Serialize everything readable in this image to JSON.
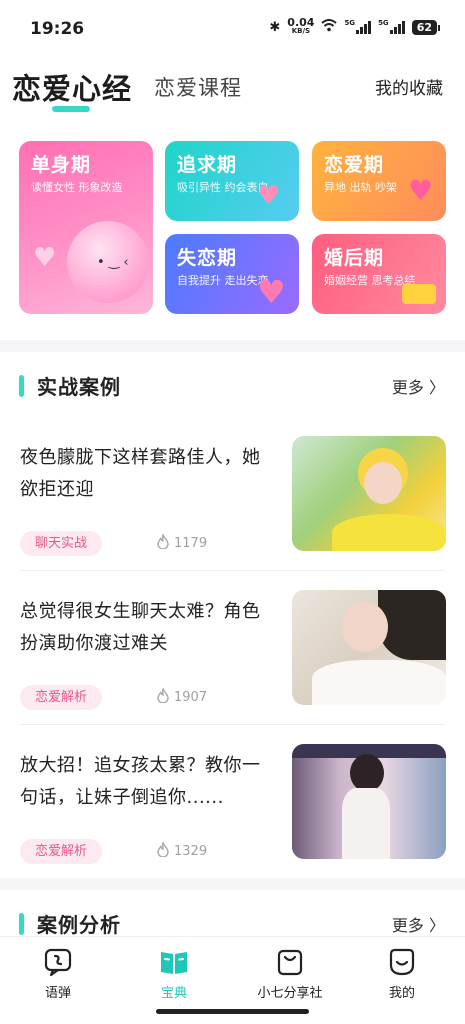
{
  "status_bar": {
    "time": "19:26",
    "net_speed": "0.04",
    "net_unit": "KB/S",
    "sim1": "5G",
    "sim2": "5G",
    "battery": "62"
  },
  "header": {
    "active_tab": "恋爱心经",
    "inactive_tab": "恋爱课程",
    "favorites": "我的收藏"
  },
  "categories": [
    {
      "title": "单身期",
      "subtitle": "读懂女性  形象改造"
    },
    {
      "title": "追求期",
      "subtitle": "吸引异性  约会表白"
    },
    {
      "title": "恋爱期",
      "subtitle": "异地  出轨  吵架"
    },
    {
      "title": "失恋期",
      "subtitle": "自我提升  走出失恋"
    },
    {
      "title": "婚后期",
      "subtitle": "婚姻经营  思考总结"
    }
  ],
  "sections": {
    "practice": {
      "title": "实战案例",
      "more": "更多 〉"
    },
    "analysis": {
      "title": "案例分析",
      "more": "更多 〉"
    }
  },
  "articles": [
    {
      "title": "夜色朦胧下这样套路佳人，她欲拒还迎",
      "tag": "聊天实战",
      "views": "1179"
    },
    {
      "title": "总觉得很女生聊天太难？角色扮演助你渡过难关",
      "tag": "恋爱解析",
      "views": "1907"
    },
    {
      "title": "放大招！追女孩太累？教你一句话，让妹子倒追你......",
      "tag": "恋爱解析",
      "views": "1329"
    }
  ],
  "bottom_nav": [
    {
      "label": "语弹",
      "icon": "chat-icon"
    },
    {
      "label": "宝典",
      "icon": "book-icon"
    },
    {
      "label": "小七分享社",
      "icon": "bag-icon"
    },
    {
      "label": "我的",
      "icon": "face-icon"
    }
  ],
  "colors": {
    "accent": "#34d9c8",
    "tag_bg": "#fdeaf0",
    "tag_text": "#e75a87"
  }
}
